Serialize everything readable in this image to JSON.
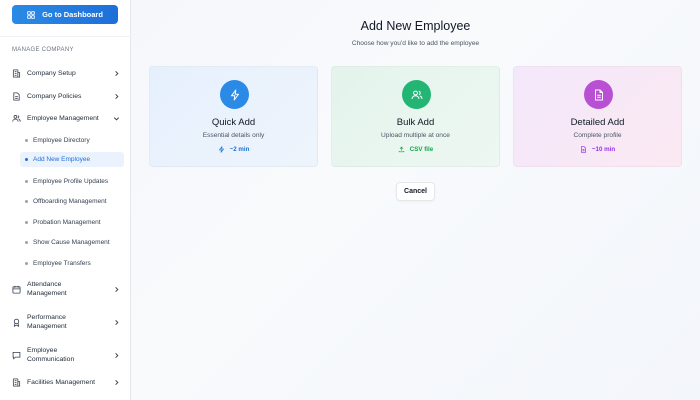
{
  "sidebar": {
    "dashboard_button": "Go to Dashboard",
    "section_label": "MANAGE COMPANY",
    "items": {
      "company_setup": "Company Setup",
      "company_policies": "Company Policies",
      "employee_management": "Employee Management",
      "attendance_line1": "Attendance",
      "attendance_line2": "Management",
      "performance_line1": "Performance",
      "performance_line2": "Management",
      "communication_line1": "Employee",
      "communication_line2": "Communication",
      "facilities": "Facilities Management"
    },
    "subitems": [
      "Employee Directory",
      "Add New Employee",
      "Employee Profile Updates",
      "Offboarding Management",
      "Probation Management",
      "Show Cause Management",
      "Employee Transfers"
    ],
    "active_subitem": "Add New Employee"
  },
  "main": {
    "title": "Add New Employee",
    "subtitle": "Choose how you'd like to add the employee",
    "cards": {
      "quick": {
        "title": "Quick Add",
        "desc": "Essential details only",
        "meta": "~2 min",
        "icon": "lightning-icon",
        "color": "#2b8ae6",
        "meta_color": "#1d6fd8"
      },
      "bulk": {
        "title": "Bulk Add",
        "desc": "Upload multiple at once",
        "meta": "CSV file",
        "icon": "users-icon",
        "color": "#22b573",
        "meta_color": "#16a34a"
      },
      "detailed": {
        "title": "Detailed Add",
        "desc": "Complete profile",
        "meta": "~10 min",
        "icon": "document-icon",
        "color": "#b94fd3",
        "meta_color": "#9333ea"
      }
    },
    "cancel_label": "Cancel"
  }
}
